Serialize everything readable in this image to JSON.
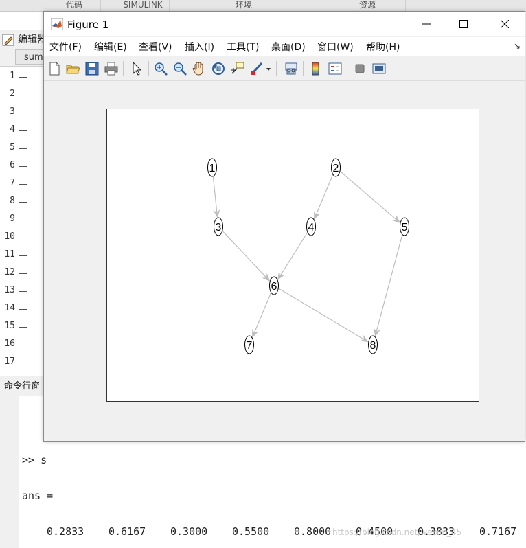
{
  "matlab_toolstrip": {
    "tabs": [
      "代码",
      "SIMULINK",
      "环境",
      "资源"
    ]
  },
  "editor": {
    "title": "编辑器",
    "tab_label": "sum",
    "line_numbers": [
      "1",
      "2",
      "3",
      "4",
      "5",
      "6",
      "7",
      "8",
      "9",
      "10",
      "11",
      "12",
      "13",
      "14",
      "15",
      "16",
      "17"
    ]
  },
  "command_window": {
    "header": "命令行窗",
    "prompt_line": ">> s",
    "ans_label": "ans =",
    "ans_values": [
      "0.2833",
      "0.6167",
      "0.3000",
      "0.5500",
      "0.8000",
      "0.4500",
      "0.3833",
      "0.7167"
    ],
    "watermark": "https://blog.csdn.net/weixin_45"
  },
  "figure": {
    "title": "Figure 1",
    "menu": [
      "文件(F)",
      "编辑(E)",
      "查看(V)",
      "插入(I)",
      "工具(T)",
      "桌面(D)",
      "窗口(W)",
      "帮助(H)"
    ],
    "toolbar_icons": [
      "new-figure-icon",
      "open-file-icon",
      "save-icon",
      "print-icon",
      "select-arrow-icon",
      "zoom-in-icon",
      "zoom-out-icon",
      "pan-icon",
      "rotate-3d-icon",
      "data-cursor-icon",
      "brush-icon",
      "link-plot-icon",
      "colorbar-icon",
      "legend-icon",
      "hide-plot-tools-icon",
      "show-plot-tools-icon"
    ]
  },
  "chart_data": {
    "type": "digraph",
    "nodes": [
      {
        "id": "1",
        "label": "1"
      },
      {
        "id": "2",
        "label": "2"
      },
      {
        "id": "3",
        "label": "3"
      },
      {
        "id": "4",
        "label": "4"
      },
      {
        "id": "5",
        "label": "5"
      },
      {
        "id": "6",
        "label": "6"
      },
      {
        "id": "7",
        "label": "7"
      },
      {
        "id": "8",
        "label": "8"
      }
    ],
    "edges": [
      {
        "from": "1",
        "to": "3"
      },
      {
        "from": "2",
        "to": "4"
      },
      {
        "from": "2",
        "to": "5"
      },
      {
        "from": "3",
        "to": "6"
      },
      {
        "from": "4",
        "to": "6"
      },
      {
        "from": "5",
        "to": "8"
      },
      {
        "from": "6",
        "to": "7"
      },
      {
        "from": "6",
        "to": "8"
      }
    ],
    "layout": "layered",
    "edge_color": "#bdbdbd",
    "node_stroke": "#000000"
  }
}
